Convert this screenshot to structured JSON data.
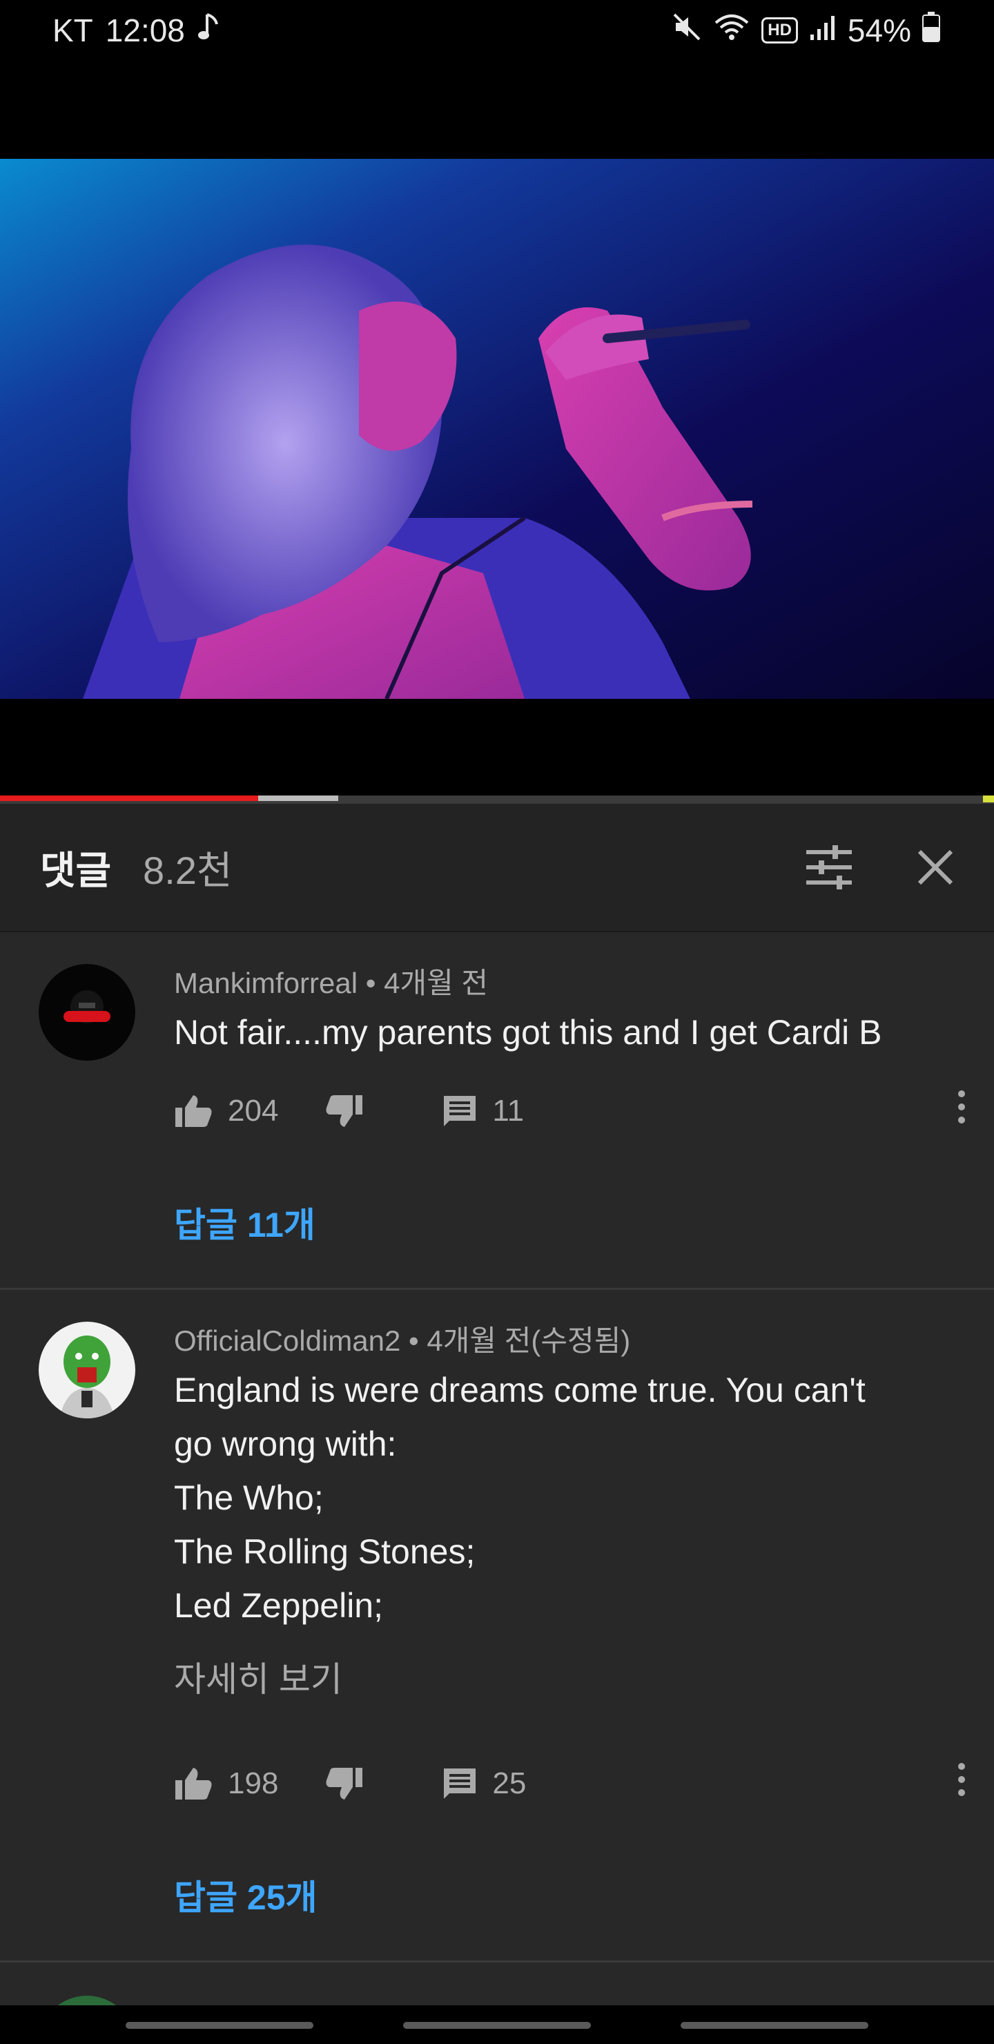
{
  "status_bar": {
    "carrier": "KT",
    "time": "12:08",
    "hd_badge": "HD",
    "battery": "54%",
    "icons": [
      "music-note-icon",
      "mute-icon",
      "wifi-icon",
      "hd-icon",
      "signal-icon",
      "battery-icon"
    ]
  },
  "video": {
    "progress_fraction": 0.26,
    "buffered_fraction": 0.34
  },
  "comments_panel": {
    "title": "댓글",
    "count": "8.2천",
    "icons": [
      "sort-filter-icon",
      "close-icon"
    ]
  },
  "comments": [
    {
      "author": "Mankimforreal",
      "meta": "Mankimforreal • 4개월 전",
      "text": "Not fair....my parents got this and I get Cardi B",
      "likes": "204",
      "reply_count": "11",
      "replies_label": "답글 11개"
    },
    {
      "author": "OfficialColdiman2",
      "meta": "OfficialColdiman2 • 4개월 전(수정됨)",
      "text_lines": [
        "England is were dreams come true. You can't",
        "go wrong with:",
        "The Who;",
        "The Rolling Stones;",
        "Led Zeppelin;"
      ],
      "read_more": "자세히 보기",
      "likes": "198",
      "reply_count": "25",
      "replies_label": "답글 25개"
    }
  ],
  "colors": {
    "background": "#282828",
    "header": "#232323",
    "accent_blue": "#3ea6ff",
    "progress_red": "#e51b1b"
  }
}
